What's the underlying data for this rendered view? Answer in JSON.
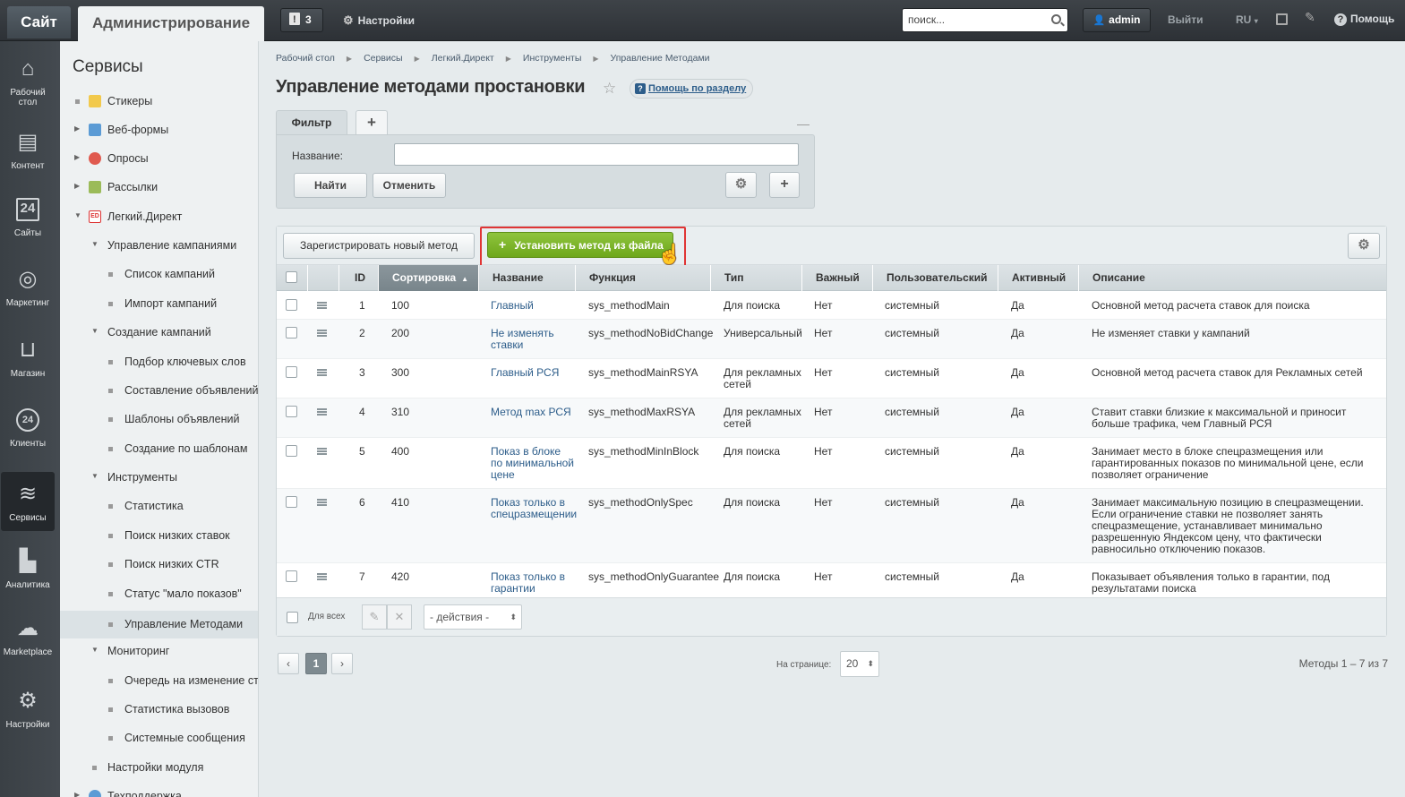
{
  "topbar": {
    "site_tab": "Сайт",
    "admin_tab": "Администрирование",
    "notifications_count": "3",
    "settings": "Настройки",
    "search_placeholder": "поиск...",
    "user": "admin",
    "logout": "Выйти",
    "lang": "RU",
    "help": "Помощь"
  },
  "iconbar": [
    {
      "label": "Рабочий стол",
      "icon": "home-icon"
    },
    {
      "label": "Контент",
      "icon": "document-icon"
    },
    {
      "label": "Сайты",
      "icon": "calendar-24-icon"
    },
    {
      "label": "Маркетинг",
      "icon": "target-icon"
    },
    {
      "label": "Магазин",
      "icon": "basket-icon"
    },
    {
      "label": "Клиенты",
      "icon": "clients-24-icon"
    },
    {
      "label": "Сервисы",
      "icon": "layers-icon"
    },
    {
      "label": "Аналитика",
      "icon": "bar-chart-icon"
    },
    {
      "label": "Marketplace",
      "icon": "cloud-download-icon"
    },
    {
      "label": "Настройки",
      "icon": "gear-icon"
    }
  ],
  "sidebar": {
    "title": "Сервисы",
    "items": [
      {
        "label": "Стикеры"
      },
      {
        "label": "Веб-формы"
      },
      {
        "label": "Опросы"
      },
      {
        "label": "Рассылки"
      },
      {
        "label": "Легкий.Директ"
      },
      {
        "label": "Управление кампаниями"
      },
      {
        "label": "Список кампаний"
      },
      {
        "label": "Импорт кампаний"
      },
      {
        "label": "Создание кампаний"
      },
      {
        "label": "Подбор ключевых слов"
      },
      {
        "label": "Составление объявлений"
      },
      {
        "label": "Шаблоны объявлений"
      },
      {
        "label": "Создание по шаблонам"
      },
      {
        "label": "Инструменты"
      },
      {
        "label": "Статистика"
      },
      {
        "label": "Поиск низких ставок"
      },
      {
        "label": "Поиск низких CTR"
      },
      {
        "label": "Статус \"мало показов\""
      },
      {
        "label": "Управление Методами"
      },
      {
        "label": "Мониторинг"
      },
      {
        "label": "Очередь на изменение ставок"
      },
      {
        "label": "Статистика вызовов"
      },
      {
        "label": "Системные сообщения"
      },
      {
        "label": "Настройки модуля"
      },
      {
        "label": "Техподдержка"
      }
    ]
  },
  "breadcrumb": [
    "Рабочий стол",
    "Сервисы",
    "Легкий.Директ",
    "Инструменты",
    "Управление Методами"
  ],
  "page": {
    "title": "Управление методами простановки",
    "help_link": "Помощь по разделу"
  },
  "filter": {
    "tab": "Фильтр",
    "field_label": "Название:",
    "field_value": "",
    "find": "Найти",
    "cancel": "Отменить"
  },
  "toolbar": {
    "register": "Зарегистрировать новый метод",
    "install": "Установить метод из файла"
  },
  "table": {
    "columns": [
      "ID",
      "Сортировка",
      "Название",
      "Функция",
      "Тип",
      "Важный",
      "Пользовательский",
      "Активный",
      "Описание"
    ],
    "rows": [
      {
        "id": "1",
        "sort": "100",
        "name": "Главный",
        "func": "sys_methodMain",
        "type": "Для поиска",
        "important": "Нет",
        "custom": "системный",
        "active": "Да",
        "desc": "Основной метод расчета ставок для поиска"
      },
      {
        "id": "2",
        "sort": "200",
        "name": "Не изменять ставки",
        "func": "sys_methodNoBidChange",
        "type": "Универсальный",
        "important": "Нет",
        "custom": "системный",
        "active": "Да",
        "desc": "Не изменяет ставки у кампаний"
      },
      {
        "id": "3",
        "sort": "300",
        "name": "Главный РСЯ",
        "func": "sys_methodMainRSYA",
        "type": "Для рекламных сетей",
        "important": "Нет",
        "custom": "системный",
        "active": "Да",
        "desc": "Основной метод расчета ставок для Рекламных сетей"
      },
      {
        "id": "4",
        "sort": "310",
        "name": "Метод max РСЯ",
        "func": "sys_methodMaxRSYA",
        "type": "Для рекламных сетей",
        "important": "Нет",
        "custom": "системный",
        "active": "Да",
        "desc": "Ставит ставки близкие к максимальной и приносит больше трафика, чем Главный РСЯ"
      },
      {
        "id": "5",
        "sort": "400",
        "name": "Показ в блоке по минимальной цене",
        "func": "sys_methodMinInBlock",
        "type": "Для поиска",
        "important": "Нет",
        "custom": "системный",
        "active": "Да",
        "desc": "Занимает место в блоке спецразмещения или гарантированных показов по минимальной цене, если позволяет ограничение"
      },
      {
        "id": "6",
        "sort": "410",
        "name": "Показ только в спецразмещении",
        "func": "sys_methodOnlySpec",
        "type": "Для поиска",
        "important": "Нет",
        "custom": "системный",
        "active": "Да",
        "desc": "Занимает максимальную позицию в спецразмещении. Если ограничение ставки не позволяет занять спецразмещение, устанавливает минимально разрешенную Яндексом цену, что фактически равносильно отключению показов."
      },
      {
        "id": "7",
        "sort": "420",
        "name": "Показ только в гарантии",
        "func": "sys_methodOnlyGuarantee",
        "type": "Для поиска",
        "important": "Нет",
        "custom": "системный",
        "active": "Да",
        "desc": "Показывает объявления только в гарантии, под результатами поиска"
      }
    ]
  },
  "footer": {
    "for_all": "Для всех",
    "actions": "- действия -",
    "per_page_label": "На странице:",
    "per_page": "20",
    "current_page": "1",
    "total": "Методы 1 – 7 из 7"
  }
}
